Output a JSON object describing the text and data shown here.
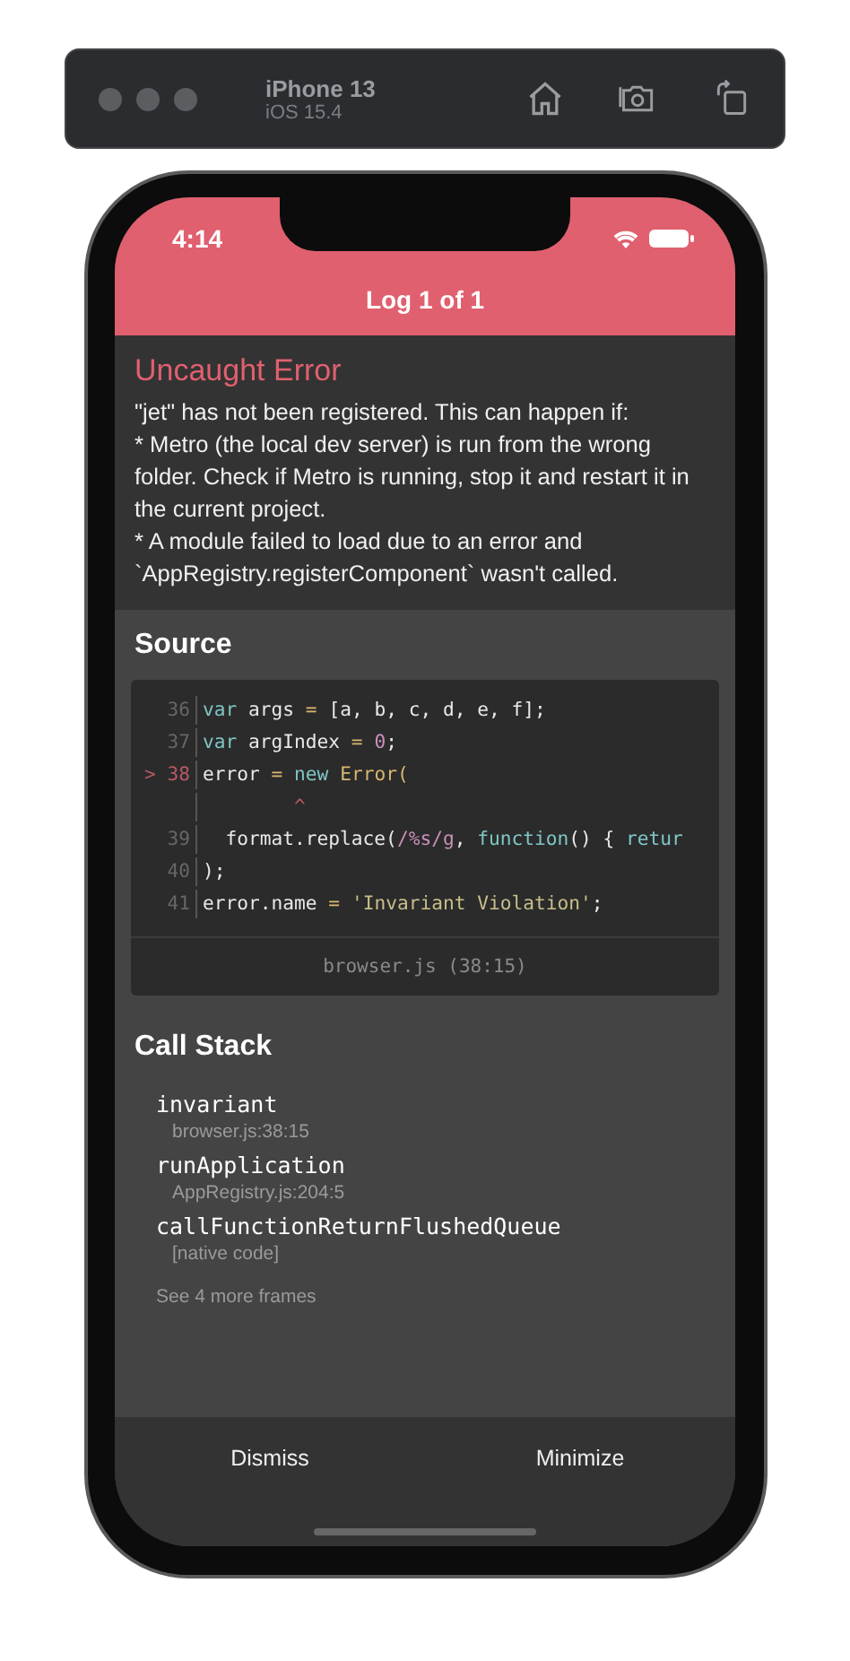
{
  "simulator": {
    "device": "iPhone 13",
    "os": "iOS 15.4"
  },
  "status_bar": {
    "time": "4:14"
  },
  "header": {
    "title": "Log 1 of 1"
  },
  "error": {
    "title": "Uncaught Error",
    "paragraphs": [
      "\"jet\" has not been registered. This can happen if:",
      "* Metro (the local dev server) is run from the wrong folder. Check if Metro is running, stop it and restart it in the current project.",
      "* A module failed to load due to an error and `AppRegistry.registerComponent` wasn't called."
    ]
  },
  "source": {
    "title": "Source",
    "lines": [
      {
        "number": "36",
        "highlighted": false,
        "segments": [
          {
            "kind": "kw",
            "text": "var"
          },
          {
            "kind": "plain",
            "text": " args "
          },
          {
            "kind": "op",
            "text": "="
          },
          {
            "kind": "plain",
            "text": " [a, b, c, d, e, f];"
          }
        ]
      },
      {
        "number": "37",
        "highlighted": false,
        "segments": [
          {
            "kind": "kw",
            "text": "var"
          },
          {
            "kind": "plain",
            "text": " argIndex "
          },
          {
            "kind": "op",
            "text": "= "
          },
          {
            "kind": "num",
            "text": "0"
          },
          {
            "kind": "plain",
            "text": ";"
          }
        ]
      },
      {
        "number": "38",
        "marker": ">",
        "highlighted": true,
        "segments": [
          {
            "kind": "plain",
            "text": "error "
          },
          {
            "kind": "op",
            "text": "= "
          },
          {
            "kind": "kw",
            "text": "new "
          },
          {
            "kind": "fn",
            "text": "Error("
          }
        ]
      },
      {
        "segments": [
          {
            "kind": "caret",
            "text": "        ^"
          }
        ]
      },
      {
        "number": "39",
        "highlighted": false,
        "segments": [
          {
            "kind": "plain",
            "text": "  format.replace("
          },
          {
            "kind": "num",
            "text": "/%s/g"
          },
          {
            "kind": "plain",
            "text": ", "
          },
          {
            "kind": "kw",
            "text": "function"
          },
          {
            "kind": "plain",
            "text": "() { "
          },
          {
            "kind": "kw",
            "text": "retur"
          }
        ]
      },
      {
        "number": "40",
        "highlighted": false,
        "segments": [
          {
            "kind": "plain",
            "text": ");"
          }
        ]
      },
      {
        "number": "41",
        "highlighted": false,
        "segments": [
          {
            "kind": "plain",
            "text": "error.name "
          },
          {
            "kind": "op",
            "text": "= "
          },
          {
            "kind": "str",
            "text": "'Invariant Violation'"
          },
          {
            "kind": "plain",
            "text": ";"
          }
        ]
      }
    ],
    "file": "browser.js (38:15)"
  },
  "call_stack": {
    "title": "Call Stack",
    "frames": [
      {
        "name": "invariant",
        "location": "browser.js:38:15"
      },
      {
        "name": "runApplication",
        "location": "AppRegistry.js:204:5"
      },
      {
        "name": "callFunctionReturnFlushedQueue",
        "location": "[native code]"
      }
    ],
    "more": "See 4 more frames"
  },
  "buttons": [
    "Dismiss",
    "Minimize"
  ]
}
